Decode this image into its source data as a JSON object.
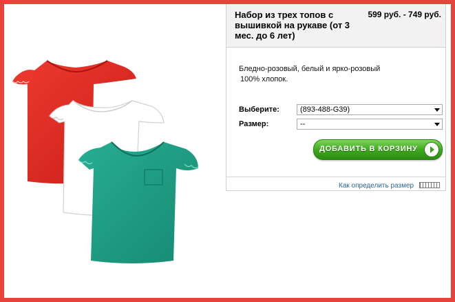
{
  "product": {
    "title": "Набор из трех топов с вышивкой на рукаве (от 3 мес. до 6 лет)",
    "price": "599 руб. - 749 руб.",
    "description_line1": "Бледно-розовый, белый и ярко-розовый",
    "description_line2": "100% хлопок.",
    "image_icon": "three-tshirts-photo"
  },
  "options": {
    "choose_label": "Выберите:",
    "choose_value": "(893-488-G39)",
    "size_label": "Размер:",
    "size_value": "--"
  },
  "actions": {
    "add_to_cart": "ДОБАВИТЬ В КОРЗИНУ",
    "size_guide": "Как определить размер",
    "size_guide_icon": "ruler-icon"
  },
  "colors": {
    "frame": "#e8433a",
    "button_green": "#3faa1f",
    "link": "#2a6496",
    "shirt_red": "#e12a22",
    "shirt_white": "#ffffff",
    "shirt_teal": "#1e9e85"
  }
}
